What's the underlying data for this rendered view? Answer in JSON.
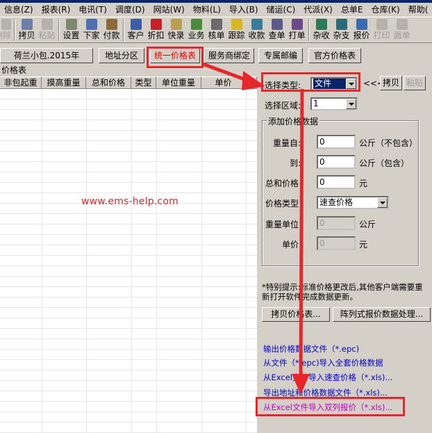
{
  "menu": [
    "信息(Z)",
    "报表(R)",
    "电讯(T)",
    "调度(D)",
    "网站(W)",
    "物料(L)",
    "导入(B)",
    "储运(C)",
    "代派(X)",
    "总单E",
    "仓库(K)",
    "帮助("
  ],
  "toolbar": {
    "delete": "删除",
    "copy": "拷贝",
    "paste": "粘贴",
    "settings": "设置",
    "order": "下家",
    "payment": "付款",
    "customer": "客户",
    "discount": "折扣",
    "quick": "快录",
    "business": "业务",
    "verify": "核单",
    "track": "跟踪",
    "receive": "收款",
    "query": "查单",
    "print_order": "打单",
    "misc_receive": "杂收",
    "misc_pay": "杂支",
    "quote": "报价",
    "print": "打印",
    "face": "面单"
  },
  "tabs": {
    "netherlands": "荷兰小包.2015年",
    "zones": "地址分区",
    "unified": "统一价格表",
    "provider": "服务商绑定",
    "postcode": "专属邮编",
    "official": "官方价格表"
  },
  "grid": {
    "label": "价格表",
    "columns": [
      "非包起重",
      "摸高重量",
      "总和价格",
      "类型",
      "单位重量",
      "单价"
    ]
  },
  "watermark": "www.ems-help.com",
  "panel": {
    "select_type_label": "选择类型:",
    "select_type_value": "文件",
    "chevrons": "<<<",
    "copy_btn": "拷贝",
    "paste_btn": "粘贴",
    "select_zone_label": "选择区域:",
    "select_zone_value": "1",
    "group_title": "添加价格数据",
    "weight_from_label": "重量自:",
    "weight_from_value": "0",
    "weight_from_unit": "公斤（不包含）",
    "weight_to_label": "到:",
    "weight_to_value": "0",
    "weight_to_unit": "公斤（包含）",
    "total_price_label": "总和价格",
    "total_price_value": "0",
    "total_price_unit": "元",
    "price_type_label": "价格类型",
    "price_type_value": "速查价格",
    "unit_weight_label": "重量单位",
    "unit_weight_value": "0",
    "unit_weight_unit": "公斤",
    "unit_price_label": "单价",
    "unit_price_value": "0",
    "unit_price_unit": "元",
    "note": "*特别提示:标准价格更改后,其他客户端需要重新打开软件完成数据更新。",
    "copy_table_btn": "拷贝价格表...",
    "matrix_btn": "阵列式报价数据处理...",
    "links": [
      "输出价格数据文件（*.epc)",
      "从文件（*.epc)导入全套价格数据",
      "从Excel文件导入速查价格（*.xls)...",
      "导出地址和价格数据文件（*.xls)..."
    ],
    "highlight_link": "从Excel文件导入双列报价（*.xls)..."
  },
  "colors": {
    "highlight": "#e8252a",
    "selection": "#0a246a",
    "link": "#0000cc",
    "link_magenta": "#c000c0"
  }
}
